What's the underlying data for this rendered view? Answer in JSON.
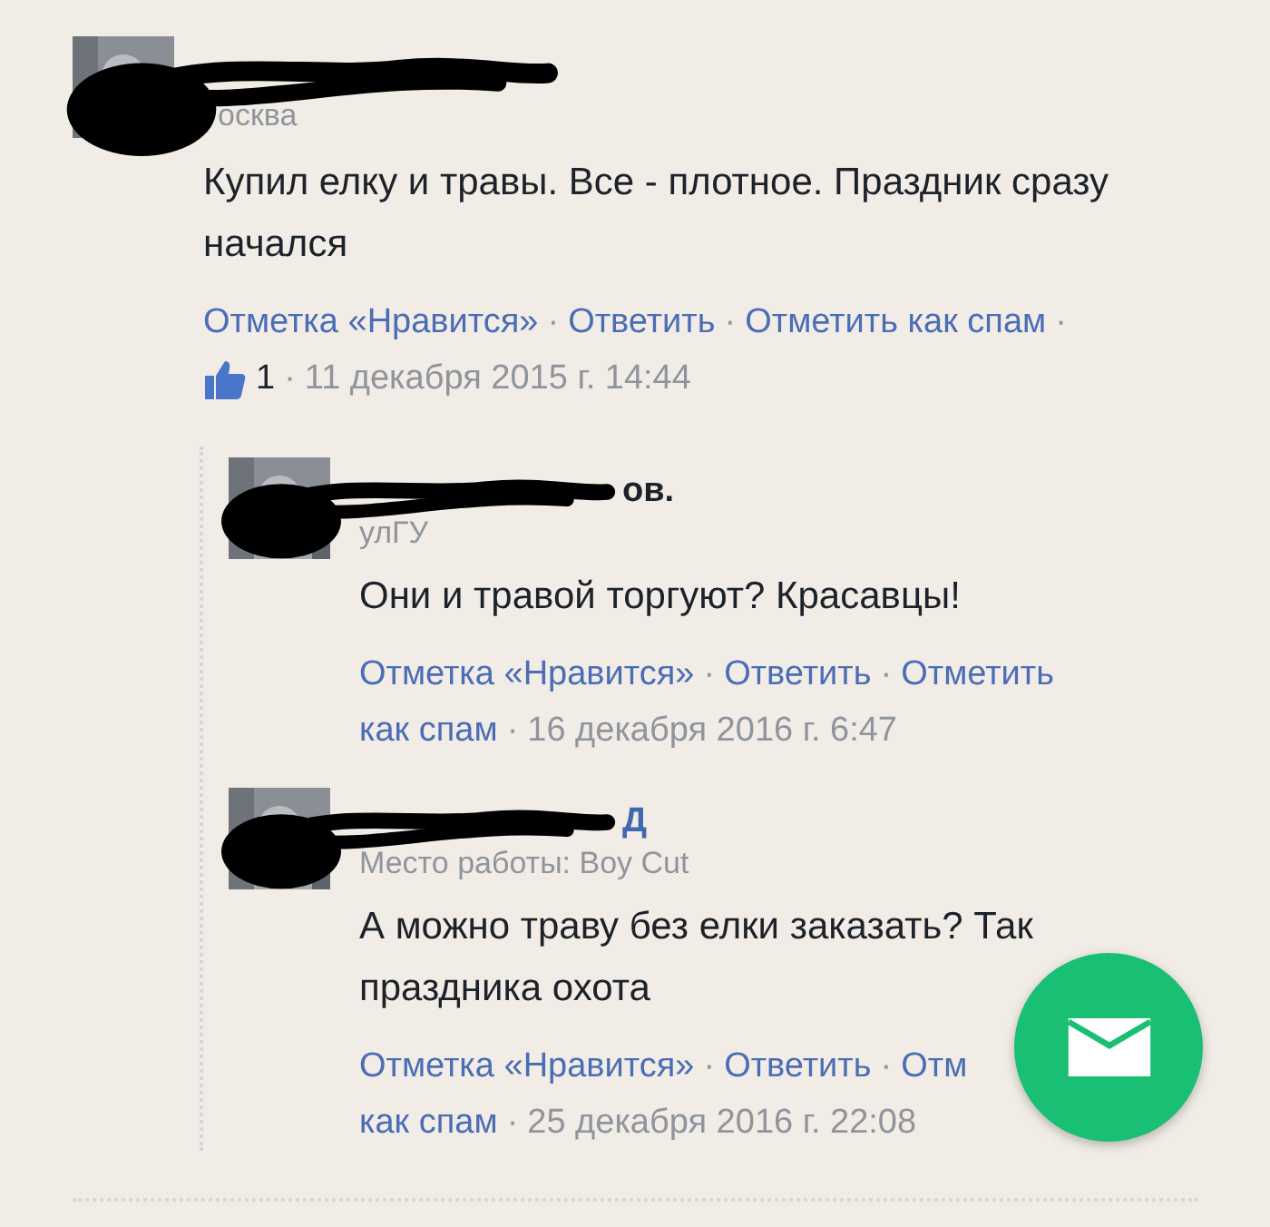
{
  "comments": [
    {
      "subtitle": "осква",
      "text": "Купил елку и травы. Все - плотное. Праздник сразу начался",
      "lines": [
        [
          {
            "kind": "link",
            "text": "Отметка «Нравится»"
          },
          {
            "kind": "separator",
            "text": "·"
          },
          {
            "kind": "link",
            "text": "Ответить"
          },
          {
            "kind": "separator",
            "text": "·"
          },
          {
            "kind": "link",
            "text": "Отметить как спам"
          },
          {
            "kind": "separator",
            "text": "·"
          }
        ],
        [
          {
            "kind": "likes",
            "text": "1"
          },
          {
            "kind": "separator",
            "text": "·"
          },
          {
            "kind": "date",
            "text": "11 декабря 2015 г. 14:44"
          }
        ]
      ],
      "replies": [
        {
          "name": "ов.",
          "subtitle": "улГУ",
          "text": "Они и травой торгуют? Красавцы!",
          "lines": [
            [
              {
                "kind": "link",
                "text": "Отметка «Нравится»"
              },
              {
                "kind": "separator",
                "text": "·"
              },
              {
                "kind": "link",
                "text": "Ответить"
              },
              {
                "kind": "separator",
                "text": "·"
              },
              {
                "kind": "link",
                "text": "Отметить"
              }
            ],
            [
              {
                "kind": "link",
                "text": "как спам"
              },
              {
                "kind": "separator",
                "text": "·"
              },
              {
                "kind": "date",
                "text": "16 декабря 2016 г. 6:47"
              }
            ]
          ]
        },
        {
          "name": "Д",
          "subtitle": "Место работы: Boy Cut",
          "text": "А можно траву без елки заказать? Так праздника охота",
          "lines": [
            [
              {
                "kind": "link",
                "text": "Отметка «Нравится»"
              },
              {
                "kind": "separator",
                "text": "·"
              },
              {
                "kind": "link",
                "text": "Ответить"
              },
              {
                "kind": "separator",
                "text": "·"
              },
              {
                "kind": "link",
                "text": "Отм"
              }
            ],
            [
              {
                "kind": "link",
                "text": "как спам"
              },
              {
                "kind": "separator",
                "text": "·"
              },
              {
                "kind": "date",
                "text": "25 декабря 2016 г. 22:08"
              }
            ]
          ]
        }
      ]
    }
  ]
}
